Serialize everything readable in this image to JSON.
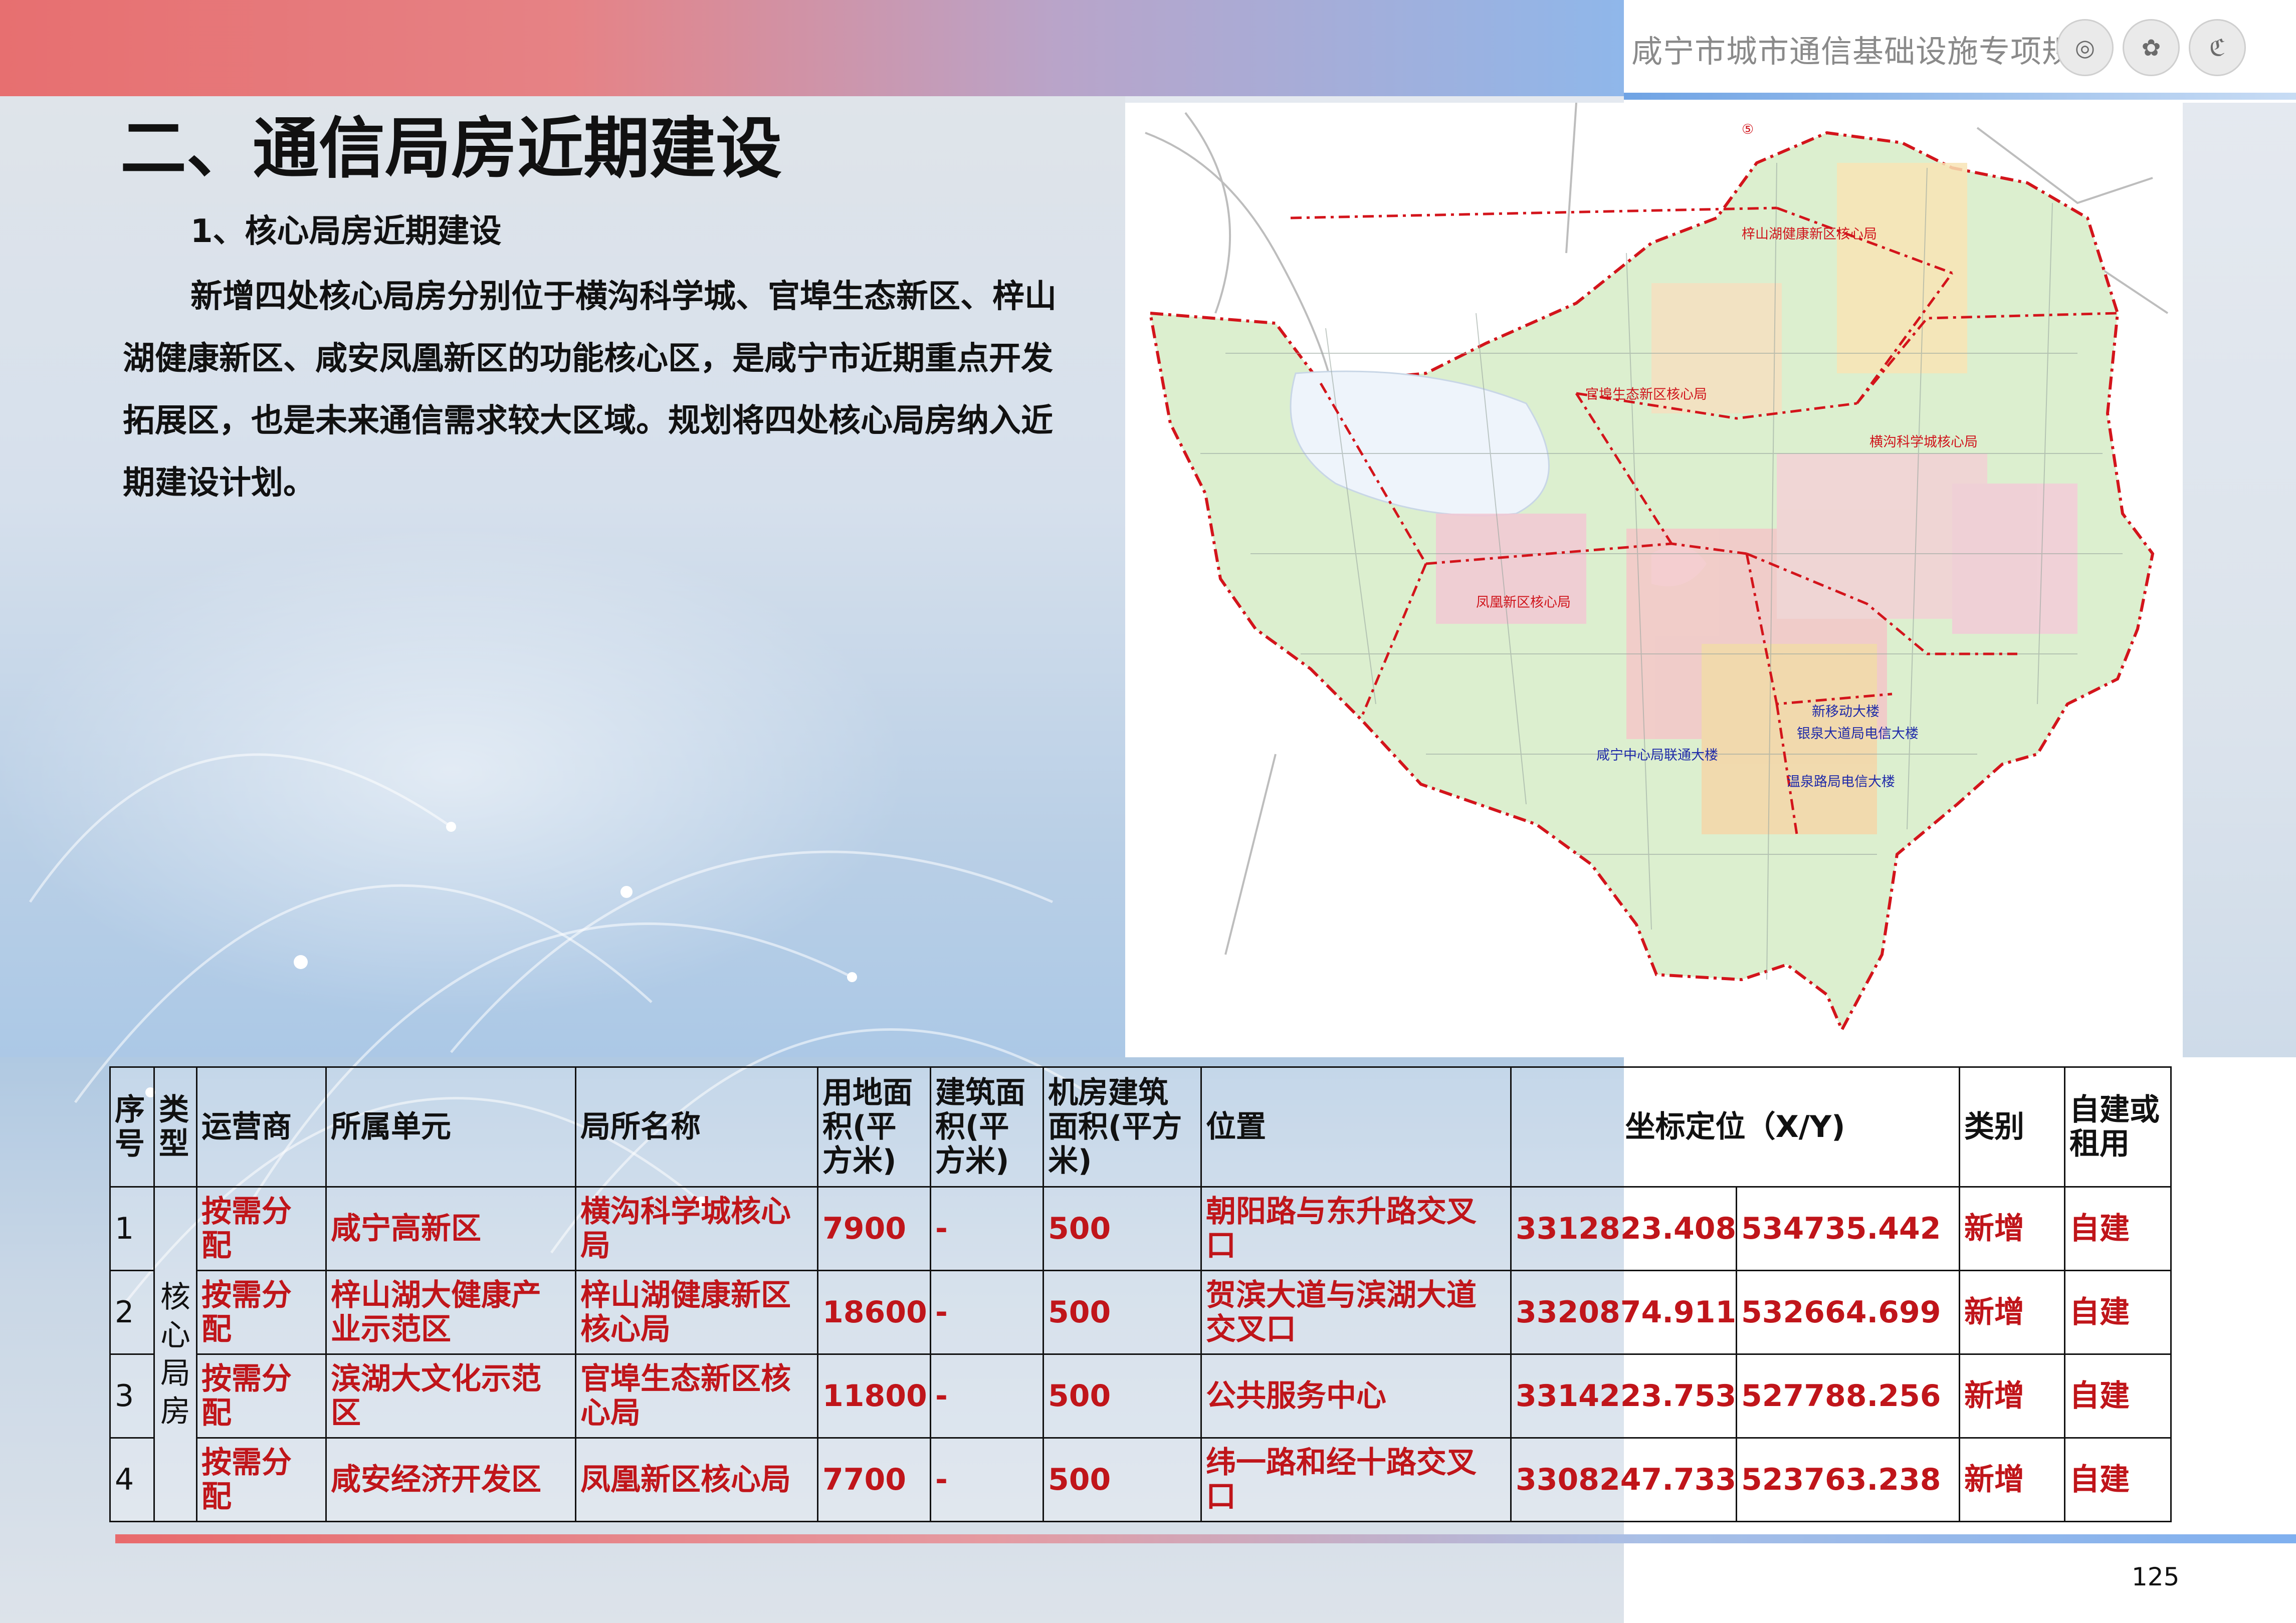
{
  "header": {
    "doc_title": "咸宁市城市通信基础设施专项规划",
    "logos": [
      "china-mobile-logo",
      "china-unicom-logo",
      "china-telecom-logo"
    ]
  },
  "page_title": "二、通信局房近期建设",
  "subtitle": "1、核心局房近期建设",
  "body_text": "新增四处核心局房分别位于横沟科学城、官埠生态新区、梓山湖健康新区、咸安凤凰新区的功能核心区，是咸宁市近期重点开发拓展区，也是未来通信需求较大区域。规划将四处核心局房纳入近期建设计划。",
  "map": {
    "red_labels": {
      "zishanhu": "梓山湖健康新区核心局",
      "guanbu": "官埠生态新区核心局",
      "henggou": "横沟科学城核心局",
      "fenghuang": "凤凰新区核心局"
    },
    "blue_labels": {
      "xinyidong": "新移动大楼",
      "yinquan": "银泉大道局电信大楼",
      "xianning_unicom": "咸宁中心局联通大楼",
      "wenquan": "温泉路局电信大楼"
    },
    "marker_symbol": "⑤"
  },
  "table": {
    "headers": {
      "seq": "序号",
      "type": "类型",
      "operator": "运营商",
      "unit": "所属单元",
      "name": "局所名称",
      "land_area": "用地面积(平方米)",
      "building_area": "建筑面积(平方米)",
      "room_area": "机房建筑面积(平方米)",
      "location": "位置",
      "coords": "坐标定位（X/Y)",
      "category": "类别",
      "own_or_rent": "自建或租用"
    },
    "type_value": "核心局房",
    "rows": [
      {
        "seq": "1",
        "operator": "按需分配",
        "unit": "咸宁高新区",
        "name": "横沟科学城核心局",
        "land_area": "7900",
        "building_area": "-",
        "room_area": "500",
        "location": "朝阳路与东升路交叉口",
        "x": "3312823.408",
        "y": "534735.442",
        "category": "新增",
        "own_or_rent": "自建"
      },
      {
        "seq": "2",
        "operator": "按需分配",
        "unit": "梓山湖大健康产业示范区",
        "name": "梓山湖健康新区核心局",
        "land_area": "18600",
        "building_area": "-",
        "room_area": "500",
        "location": "贺滨大道与滨湖大道交叉口",
        "x": "3320874.911",
        "y": "532664.699",
        "category": "新增",
        "own_or_rent": "自建"
      },
      {
        "seq": "3",
        "operator": "按需分配",
        "unit": "滨湖大文化示范区",
        "name": "官埠生态新区核心局",
        "land_area": "11800",
        "building_area": "-",
        "room_area": "500",
        "location": "公共服务中心",
        "x": "3314223.753",
        "y": "527788.256",
        "category": "新增",
        "own_or_rent": "自建"
      },
      {
        "seq": "4",
        "operator": "按需分配",
        "unit": "咸安经济开发区",
        "name": "凤凰新区核心局",
        "land_area": "7700",
        "building_area": "-",
        "room_area": "500",
        "location": "纬一路和经十路交叉口",
        "x": "3308247.733",
        "y": "523763.238",
        "category": "新增",
        "own_or_rent": "自建"
      }
    ]
  },
  "page_number": "125",
  "colors": {
    "accent_red": "#c0151a",
    "label_blue": "#1f2aa8",
    "banner_start": "#e76f70",
    "banner_end": "#8fb7ea"
  }
}
